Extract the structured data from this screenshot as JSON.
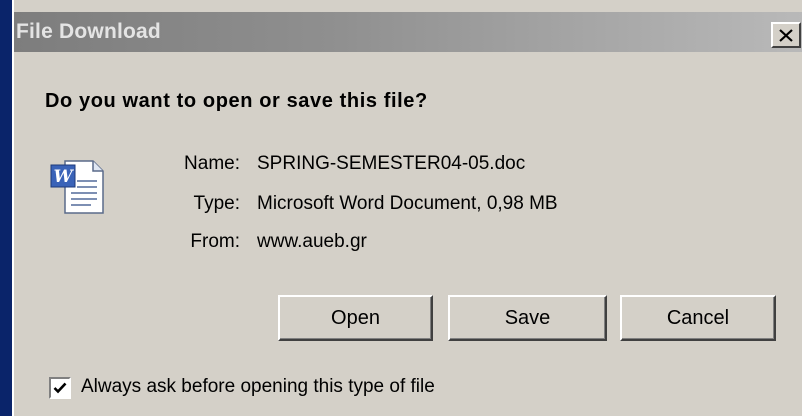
{
  "dialog": {
    "title": "File Download",
    "close_glyph": "X",
    "question": "Do you want to open or save this file?",
    "icon": "word-document-icon",
    "fields": {
      "name_label": "Name:",
      "name_value": "SPRING-SEMESTER04-05.doc",
      "type_label": "Type:",
      "type_value": "Microsoft Word Document, 0,98 MB",
      "from_label": "From:",
      "from_value": "www.aueb.gr"
    },
    "buttons": {
      "open": "Open",
      "save": "Save",
      "cancel": "Cancel"
    },
    "checkbox": {
      "label": "Always ask before opening this type of file",
      "checked": true
    }
  },
  "colors": {
    "window_bg": "#d4d0c8",
    "titlebar_inactive": "#808080",
    "desktop": "#0a246a"
  }
}
